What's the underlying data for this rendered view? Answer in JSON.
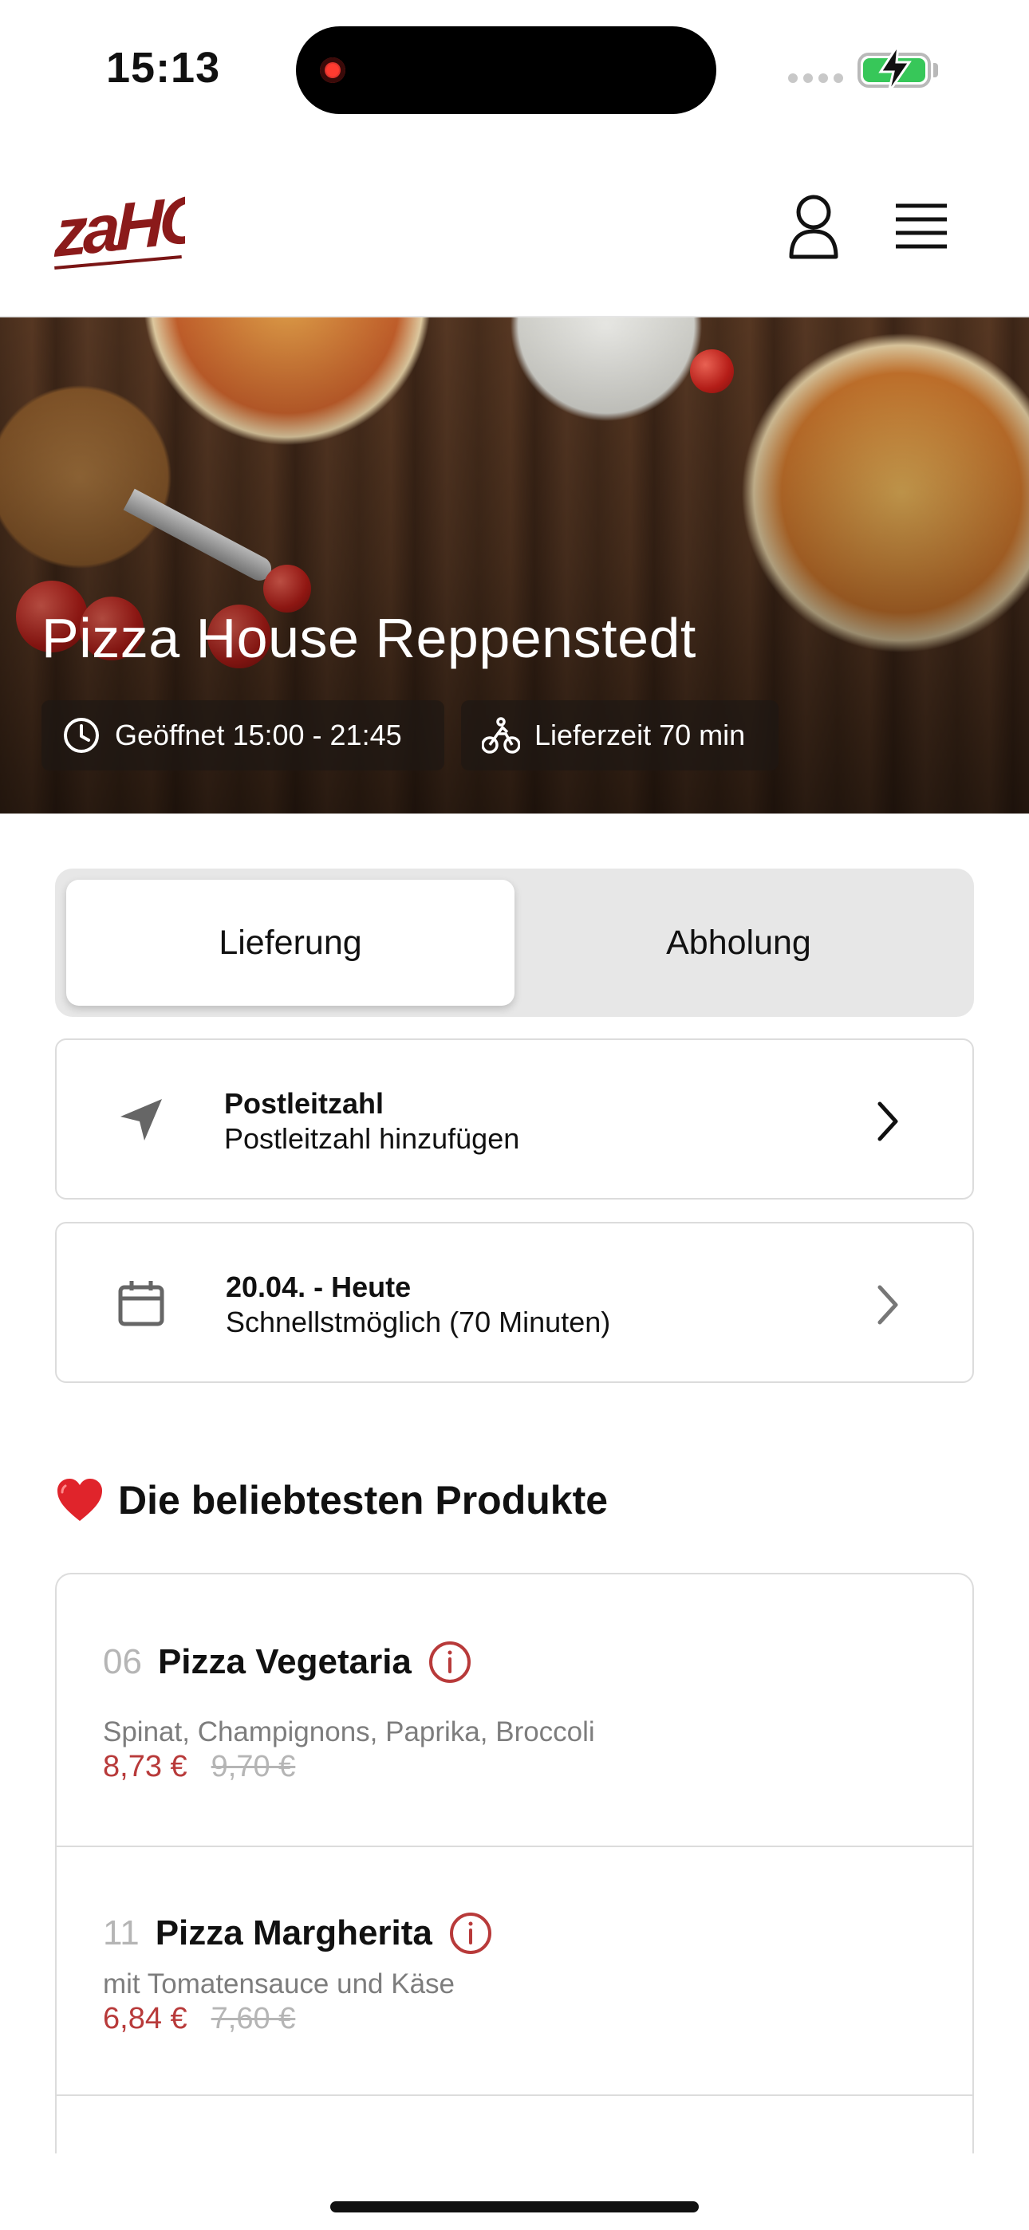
{
  "status_bar": {
    "time": "15:13"
  },
  "header": {
    "logo_text": "zaHO",
    "icons": [
      "user-icon",
      "menu-icon"
    ]
  },
  "hero": {
    "title": "Pizza House Reppenstedt",
    "opening_label": "Geöffnet 15:00 - 21:45",
    "delivery_label": "Lieferzeit 70 min"
  },
  "order_type": {
    "options": [
      "Lieferung",
      "Abholung"
    ],
    "selected": "Lieferung"
  },
  "zip_card": {
    "title": "Postleitzahl",
    "subtitle": "Postleitzahl hinzufügen"
  },
  "date_card": {
    "title": "20.04. - Heute",
    "subtitle": "Schnellstmöglich (70 Minuten)"
  },
  "popular": {
    "title": "Die beliebtesten Produkte",
    "products": [
      {
        "number": "06",
        "name": "Pizza Vegetaria",
        "description": "Spinat, Champignons, Paprika, Broccoli",
        "price": "8,73 €",
        "old_price": "9,70 €"
      },
      {
        "number": "11",
        "name": "Pizza Margherita",
        "description": "mit Tomatensauce und Käse",
        "price": "6,84 €",
        "old_price": "7,60 €"
      }
    ]
  },
  "colors": {
    "accent": "#b83a3a",
    "brand": "#8b1a1a",
    "battery": "#37c759"
  }
}
